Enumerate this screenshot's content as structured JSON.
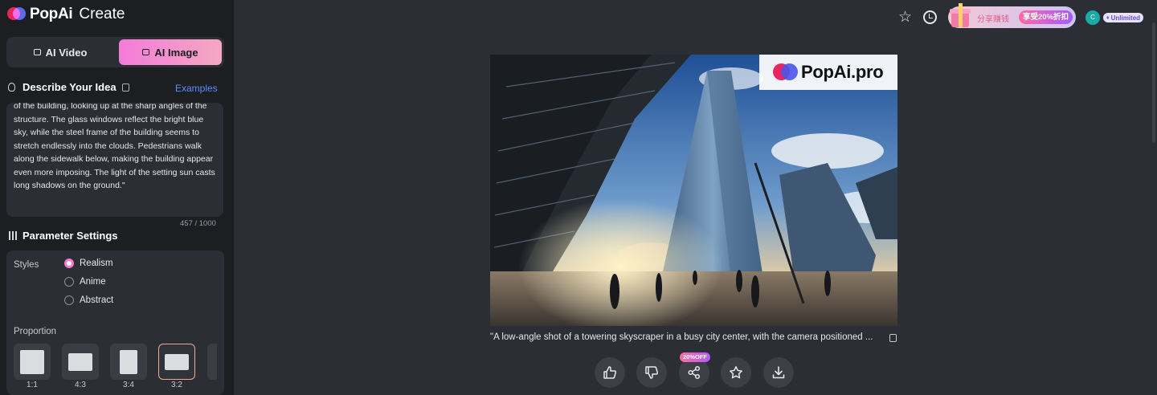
{
  "app": {
    "brand": "PopAi",
    "section": "Create"
  },
  "modes": {
    "video_label": "AI Video",
    "image_label": "AI Image",
    "active": "AI Image"
  },
  "describe": {
    "title": "Describe Your Idea",
    "examples_link": "Examples",
    "prompt_text": "of the building, looking up at the sharp angles of the structure. The glass windows reflect the bright blue sky, while the steel frame of the building seems to stretch endlessly into the clouds. Pedestrians walk along the sidewalk below, making the building appear even more imposing. The light of the setting sun casts long shadows on the ground.\"",
    "char_count": "457 / 1000"
  },
  "params": {
    "title": "Parameter Settings",
    "styles_label": "Styles",
    "styles": [
      {
        "label": "Realism",
        "selected": true
      },
      {
        "label": "Anime",
        "selected": false
      },
      {
        "label": "Abstract",
        "selected": false
      }
    ],
    "proportion_label": "Proportion",
    "proportions": [
      {
        "label": "1:1",
        "selected": false
      },
      {
        "label": "4:3",
        "selected": false
      },
      {
        "label": "3:4",
        "selected": false
      },
      {
        "label": "3:2",
        "selected": true
      }
    ]
  },
  "topbar": {
    "favorites_icon": "star-icon",
    "history_icon": "history-icon",
    "promo_text": "分享赚钱",
    "promo_badge": "享受20%折扣",
    "avatar_initial": "C",
    "plan_badge": "Unlimited"
  },
  "result": {
    "watermark": "PopAi.pro",
    "caption": "\"A low-angle shot of a towering skyscraper in a busy city center, with the camera positioned ...",
    "share_badge": "20%OFF",
    "actions": [
      "thumbs-up-icon",
      "thumbs-down-icon",
      "share-icon",
      "star-icon",
      "download-icon"
    ]
  },
  "colors": {
    "accent_pink": "#f57ad6",
    "link_blue": "#5b8cff",
    "sidebar_bg": "#1c1e22",
    "main_bg": "#2b2e34"
  }
}
